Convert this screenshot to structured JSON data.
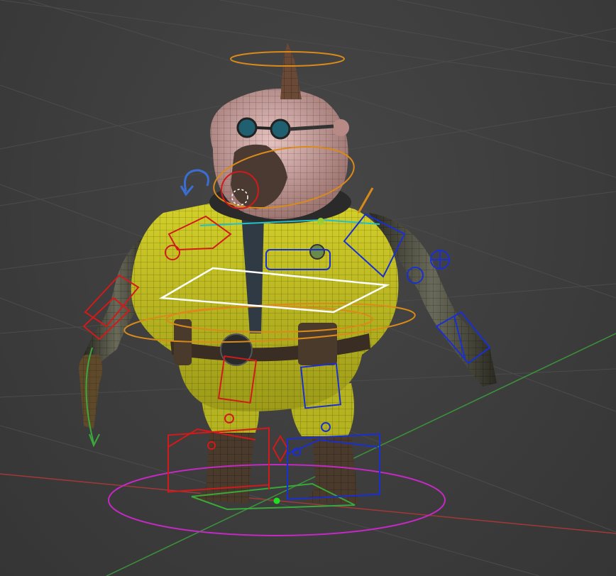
{
  "viewport": {
    "view_type": "3d-perspective",
    "colors": {
      "background": "#3d3d3d",
      "grid_line": "#4a4a4a",
      "x_axis": "#b03a3a",
      "y_axis": "#3f9a3f",
      "rig_left": "#d11a1a",
      "rig_right": "#1a2fd1",
      "rig_center": "#d98a1a",
      "rig_cyan": "#22c0c8",
      "rig_white": "#ffffff",
      "rig_root": "#c32ac3",
      "suit_yellow": "#d9d52a",
      "skin": "#d9a9a6"
    }
  },
  "scene": {
    "character": "stylized-rigged-character",
    "controls": {
      "head_ring": "head-control",
      "neck_ring": "neck-control",
      "chest_box": "chest-control",
      "hip_ring": "hip-control",
      "root_ellipse": "root-control",
      "left_foot_ik": "foot-ik-left",
      "right_foot_ik": "foot-ik-right",
      "left_hand_ik": "hand-ik-left",
      "right_hand_ik": "hand-ik-right"
    }
  }
}
